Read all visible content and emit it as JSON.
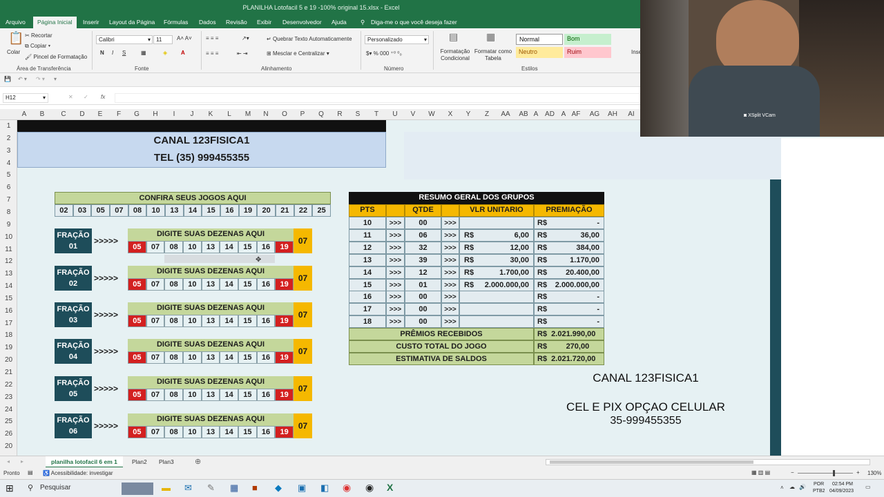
{
  "window": {
    "title": "PLANILHA Lotofacil 5 e 19 -100% original 15.xlsx  -  Excel"
  },
  "ribbon_tabs": [
    "Arquivo",
    "Página Inicial",
    "Inserir",
    "Layout da Página",
    "Fórmulas",
    "Dados",
    "Revisão",
    "Exibir",
    "Desenvolvedor",
    "Ajuda",
    "Diga-me o que você deseja fazer"
  ],
  "ribbon": {
    "paste": "Colar",
    "cut": "Recortar",
    "copy": "Copiar",
    "format_painter": "Pincel de Formatação",
    "clipboard_group": "Área de Transferência",
    "font_name": "Calibri",
    "font_size": "11",
    "font_group": "Fonte",
    "wrap": "Quebrar Texto Automaticamente",
    "merge": "Mesclar e Centralizar",
    "align_group": "Alinhamento",
    "number_format": "Personalizado",
    "number_group": "Número",
    "cond_format": "Formatação Condicional",
    "format_table": "Formatar como Tabela",
    "styles": {
      "normal": "Normal",
      "bom": "Bom",
      "neutro": "Neutro",
      "ruim": "Ruim"
    },
    "styles_group": "Estilos",
    "insert": "Inse"
  },
  "namebox": "H12",
  "fx": "fx",
  "columns": [
    "A",
    "B",
    "C",
    "D",
    "E",
    "F",
    "G",
    "H",
    "I",
    "J",
    "K",
    "L",
    "M",
    "N",
    "O",
    "P",
    "Q",
    "R",
    "S",
    "T",
    "U",
    "V",
    "W",
    "X",
    "Y",
    "Z",
    "AA",
    "AB",
    "A",
    "AD",
    "A",
    "AF",
    "AG",
    "AH",
    "AI"
  ],
  "rows": [
    "1",
    "2",
    "3",
    "4",
    "5",
    "6",
    "7",
    "8",
    "9",
    "10",
    "11",
    "12",
    "13",
    "14",
    "15",
    "16",
    "17",
    "18",
    "19",
    "20",
    "21",
    "22",
    "23",
    "24",
    "25",
    "26",
    "20"
  ],
  "header": {
    "line1": "CANAL 123FISICA1",
    "line2": "TEL (35) 999455355"
  },
  "confira": {
    "title": "CONFIRA SEUS JOGOS AQUI",
    "numbers": [
      "02",
      "03",
      "05",
      "07",
      "08",
      "10",
      "13",
      "14",
      "15",
      "16",
      "19",
      "20",
      "21",
      "22",
      "25"
    ]
  },
  "fracoes": [
    {
      "label": "FRAÇÃO",
      "num": "01"
    },
    {
      "label": "FRAÇÃO",
      "num": "02"
    },
    {
      "label": "FRAÇÃO",
      "num": "03"
    },
    {
      "label": "FRAÇÃO",
      "num": "04"
    },
    {
      "label": "FRAÇÃO",
      "num": "05"
    },
    {
      "label": "FRAÇÃO",
      "num": "06"
    }
  ],
  "arrows": ">>>>>",
  "digite": "DIGITE SUAS DEZENAS AQUI",
  "dezenas": [
    "05",
    "07",
    "08",
    "10",
    "13",
    "14",
    "15",
    "16",
    "19"
  ],
  "extra": "07",
  "resumo": {
    "title": "RESUMO GERAL DOS GRUPOS",
    "headers": [
      "PTS",
      "QTDE",
      "VLR UNITARIO",
      "PREMIAÇÃO"
    ],
    "arrow": ">>>",
    "currency": "R$",
    "rows": [
      {
        "pts": "10",
        "qtde": "00",
        "vlr": "",
        "prem": "-"
      },
      {
        "pts": "11",
        "qtde": "06",
        "vlr": "6,00",
        "prem": "36,00"
      },
      {
        "pts": "12",
        "qtde": "32",
        "vlr": "12,00",
        "prem": "384,00"
      },
      {
        "pts": "13",
        "qtde": "39",
        "vlr": "30,00",
        "prem": "1.170,00"
      },
      {
        "pts": "14",
        "qtde": "12",
        "vlr": "1.700,00",
        "prem": "20.400,00"
      },
      {
        "pts": "15",
        "qtde": "01",
        "vlr": "2.000.000,00",
        "prem": "2.000.000,00"
      },
      {
        "pts": "16",
        "qtde": "00",
        "vlr": "",
        "prem": "-"
      },
      {
        "pts": "17",
        "qtde": "00",
        "vlr": "",
        "prem": "-"
      },
      {
        "pts": "18",
        "qtde": "00",
        "vlr": "",
        "prem": "-"
      }
    ],
    "totals": [
      {
        "label": "PRÊMIOS RECEBIDOS",
        "value": "R$  2.021.990,00"
      },
      {
        "label": "CUSTO TOTAL DO JOGO",
        "value": "R$         270,00"
      },
      {
        "label": "ESTIMATIVA DE SALDOS",
        "value": "R$  2.021.720,00"
      }
    ]
  },
  "canal_text": {
    "line1": "CANAL 123FISICA1",
    "line2": "CEL E PIX OPÇAO CELULAR",
    "line3": "35-999455355"
  },
  "sheet_tabs": [
    "planilha lotofacil 6 em 1",
    "Plan2",
    "Plan3"
  ],
  "status": {
    "ready": "Pronto",
    "accessibility": "Acessibilidade: investigar",
    "zoom": "130%"
  },
  "taskbar": {
    "search": "Pesquisar",
    "lang": "POR",
    "layout": "PTB2",
    "time": "02:54 PM",
    "date": "04/09/2023"
  },
  "webcam_label": "XSplit VCam"
}
